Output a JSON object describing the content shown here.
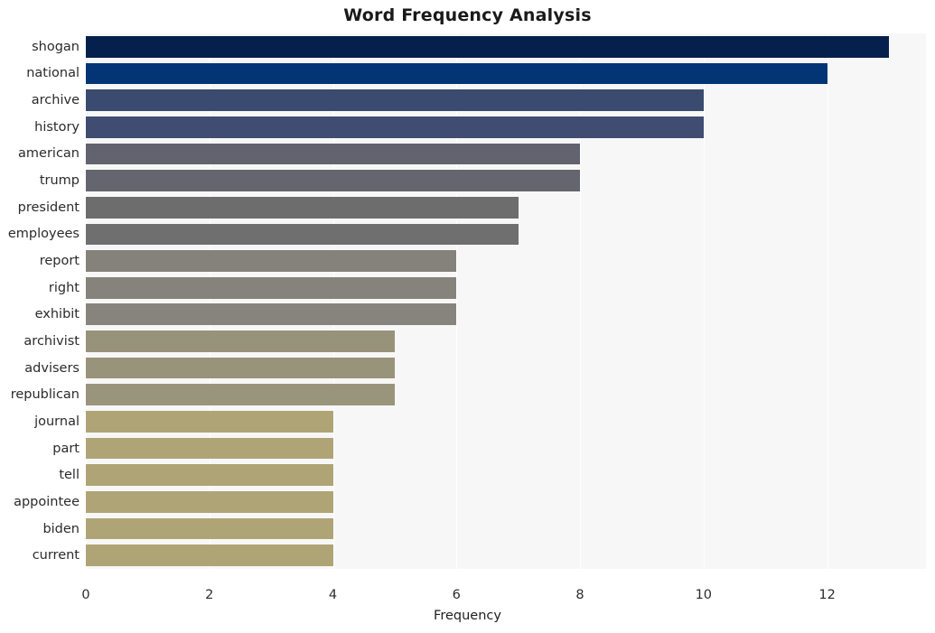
{
  "chart_data": {
    "type": "bar",
    "orientation": "horizontal",
    "title": "Word Frequency Analysis",
    "xlabel": "Frequency",
    "ylabel": "",
    "categories": [
      "shogan",
      "national",
      "archive",
      "history",
      "american",
      "trump",
      "president",
      "employees",
      "report",
      "right",
      "exhibit",
      "archivist",
      "advisers",
      "republican",
      "journal",
      "part",
      "tell",
      "appointee",
      "biden",
      "current"
    ],
    "values": [
      13,
      12,
      10,
      10,
      8,
      8,
      7,
      7,
      6,
      6,
      6,
      5,
      5,
      5,
      4,
      4,
      4,
      4,
      4,
      4
    ],
    "xticks": [
      0,
      2,
      4,
      6,
      8,
      10,
      12
    ],
    "xlim": [
      0,
      13.6
    ],
    "grid": true,
    "legend": null,
    "bar_colors": [
      "#06204d",
      "#033575",
      "#3b4a6f",
      "#404c72",
      "#62636e",
      "#64656f",
      "#6d6d6d",
      "#6f6f6f",
      "#84827a",
      "#85837b",
      "#86847c",
      "#97927a",
      "#98937b",
      "#99947c",
      "#afa475",
      "#afa475",
      "#afa475",
      "#afa475",
      "#afa475",
      "#afa475"
    ],
    "plot_bg": "#f7f7f7",
    "figure_bg": "#ffffff",
    "title_color": "#1a1a1a",
    "tick_color": "#2b2b2b"
  }
}
